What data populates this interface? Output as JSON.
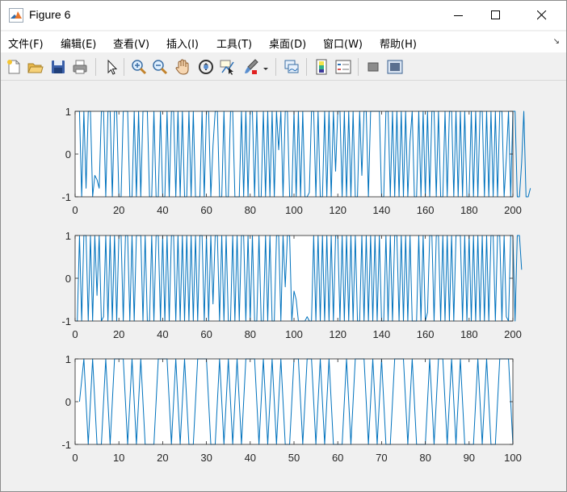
{
  "window": {
    "title": "Figure 6",
    "controls": [
      "minimize",
      "maximize",
      "close"
    ]
  },
  "menu": {
    "items": [
      "文件(F)",
      "编辑(E)",
      "查看(V)",
      "插入(I)",
      "工具(T)",
      "桌面(D)",
      "窗口(W)",
      "帮助(H)"
    ]
  },
  "toolbar": {
    "icons": [
      "new-figure-icon",
      "open-file-icon",
      "save-icon",
      "print-icon",
      "select-pointer-icon",
      "zoom-in-icon",
      "zoom-out-icon",
      "pan-hand-icon",
      "rotate-3d-icon",
      "data-cursor-icon",
      "brush-icon",
      "brush-dropdown-icon",
      "link-plot-icon",
      "colorbar-icon",
      "legend-icon",
      "hide-plot-tools-icon",
      "show-plot-tools-icon"
    ]
  },
  "colors": {
    "line": "#0072BD",
    "axes_bg": "#ffffff",
    "figure_bg": "#f0f0f0"
  },
  "chart_data": [
    {
      "type": "line",
      "xlim": [
        0,
        200
      ],
      "ylim": [
        -1,
        1
      ],
      "xticks": [
        0,
        20,
        40,
        60,
        80,
        100,
        120,
        140,
        160,
        180,
        200
      ],
      "yticks": [
        -1,
        0,
        1
      ],
      "grid": false,
      "series": [
        {
          "x_start": 1,
          "values": [
            1,
            1,
            -1,
            1,
            -0.8,
            1,
            1,
            -1,
            -0.5,
            -0.6,
            -0.8,
            1,
            1,
            -1,
            1,
            1,
            -1,
            1,
            1,
            -1,
            -1,
            1,
            1,
            1,
            -1,
            -1,
            1,
            -1,
            1,
            -1,
            1,
            1,
            1,
            -1,
            -1,
            1,
            -1,
            -1,
            1,
            -1,
            -1,
            1,
            -1,
            1,
            1,
            -1,
            1,
            -1,
            1,
            -1,
            -1,
            1,
            -1,
            1,
            -1,
            -1,
            -1,
            1,
            -1,
            1,
            1,
            -1,
            0.2,
            1,
            1,
            -1,
            -1,
            1,
            -1,
            -1,
            1,
            1,
            -1,
            -1,
            -1,
            1,
            -1,
            1,
            -1,
            1,
            1,
            -1,
            1,
            -1,
            -1,
            1,
            -1,
            1,
            -1,
            1,
            -1,
            1,
            0.1,
            1,
            -1,
            1,
            1,
            -1,
            -1,
            1,
            -1,
            1,
            -1,
            1,
            -1,
            -1,
            -0.9,
            1,
            1,
            -1,
            1,
            -1,
            -1,
            1,
            -1,
            1,
            -1,
            1,
            -0.4,
            1,
            1,
            -1,
            1,
            -1,
            1,
            -1,
            1,
            -1,
            -1,
            1,
            -0.5,
            1,
            1,
            -1,
            1,
            1,
            1,
            1,
            1,
            -1,
            -1,
            1,
            1,
            -1,
            1,
            -1,
            1,
            -1,
            1,
            -1,
            1,
            -1,
            0.3,
            1,
            -1,
            -1,
            1,
            -1,
            1,
            -1,
            1,
            -1,
            1,
            1,
            -1,
            1,
            -1,
            -1,
            1,
            -1,
            1,
            1,
            -1,
            1,
            -1,
            1,
            -1,
            1,
            -1,
            -1,
            1,
            -1,
            1,
            -1,
            1,
            1,
            -1,
            1,
            -1,
            1,
            -1,
            1,
            -1,
            1,
            1,
            -1,
            -0.1,
            1,
            -1,
            1,
            1,
            -1,
            -1,
            -0.2,
            1,
            -1,
            -1,
            -0.8
          ]
        }
      ]
    },
    {
      "type": "line",
      "xlim": [
        0,
        200
      ],
      "ylim": [
        -1,
        1
      ],
      "xticks": [
        0,
        20,
        40,
        60,
        80,
        100,
        120,
        140,
        160,
        180,
        200
      ],
      "yticks": [
        -1,
        0,
        1
      ],
      "grid": false,
      "series": [
        {
          "x_start": 1,
          "values": [
            -1,
            1,
            -1,
            1,
            1,
            -1,
            1,
            -1,
            1,
            -0.4,
            1,
            -1,
            -0.9,
            1,
            -1,
            1,
            -1,
            1,
            -1,
            1,
            1,
            -1,
            1,
            1,
            -1,
            1,
            -1,
            1,
            1,
            1,
            -1,
            1,
            -1,
            -1,
            1,
            -1,
            1,
            1,
            -1,
            1,
            -1,
            1,
            -1,
            1,
            1,
            -1,
            1,
            -1,
            1,
            -1,
            1,
            -1,
            1,
            -1,
            1,
            -1,
            1,
            1,
            -1,
            1,
            -1,
            1,
            -0.6,
            1,
            1,
            -1,
            1,
            -1,
            1,
            -1,
            -1,
            1,
            -1,
            1,
            -1,
            1,
            1,
            -1,
            1,
            -1,
            1,
            -1,
            -1,
            1,
            -1,
            -1,
            1,
            -1,
            1,
            -1,
            -1,
            1,
            1,
            -1,
            1,
            -0.2,
            1,
            1,
            -1,
            -0.3,
            -0.5,
            -1,
            -1,
            -1,
            -1,
            -0.9,
            -1,
            -1,
            1,
            -1,
            1,
            -1,
            1,
            -1,
            1,
            -1,
            1,
            -1,
            1,
            1,
            -1,
            1,
            -1,
            1,
            -1,
            1,
            -1,
            1,
            -1,
            -1,
            1,
            -1,
            1,
            -1,
            1,
            -1,
            1,
            -1,
            1,
            -1,
            -1,
            1,
            -1,
            1,
            -1,
            1,
            1,
            -1,
            1,
            -1,
            1,
            -1,
            1,
            -1,
            -1,
            -1,
            1,
            -1,
            1,
            -1,
            -0.8,
            1,
            1,
            -1,
            1,
            1,
            -1,
            1,
            -1,
            1,
            -1,
            1,
            -1,
            1,
            1,
            1,
            -1,
            1,
            -1,
            1,
            -1,
            1,
            -1,
            1,
            -1,
            1,
            -1,
            1,
            -1,
            1,
            1,
            -1,
            1,
            1,
            -1,
            1,
            -0.9,
            -1,
            1,
            1,
            -1,
            1,
            1,
            0.2
          ]
        }
      ]
    },
    {
      "type": "line",
      "xlim": [
        0,
        100
      ],
      "ylim": [
        -1,
        1
      ],
      "xticks": [
        0,
        10,
        20,
        30,
        40,
        50,
        60,
        70,
        80,
        90,
        100
      ],
      "yticks": [
        -1,
        0,
        1
      ],
      "grid": false,
      "series": [
        {
          "x_start": 1,
          "values": [
            0,
            1,
            -1,
            1,
            -1,
            -1,
            1,
            -1,
            1,
            1,
            1,
            -1,
            1,
            -1,
            1,
            -1,
            -1,
            -1,
            1,
            1,
            1,
            -1,
            1,
            -1,
            1,
            -1,
            -1,
            1,
            1,
            1,
            -1,
            -1,
            1,
            -1,
            1,
            -1,
            1,
            -1,
            1,
            1,
            1,
            -1,
            1,
            -1,
            1,
            -1,
            1,
            -1,
            -1,
            1,
            1,
            -1,
            1,
            1,
            -1,
            1,
            -1,
            1,
            -1,
            -1,
            -1,
            1,
            -1,
            1,
            1,
            1,
            -1,
            1,
            -1,
            1,
            -1,
            -1,
            1,
            1,
            1,
            -1,
            1,
            -1,
            -1,
            -1,
            1,
            -1,
            1,
            1,
            -1,
            1,
            -1,
            1,
            -1,
            -1,
            -1,
            1,
            -1,
            1,
            -1,
            -1,
            1,
            1,
            1,
            -1
          ]
        }
      ]
    }
  ]
}
